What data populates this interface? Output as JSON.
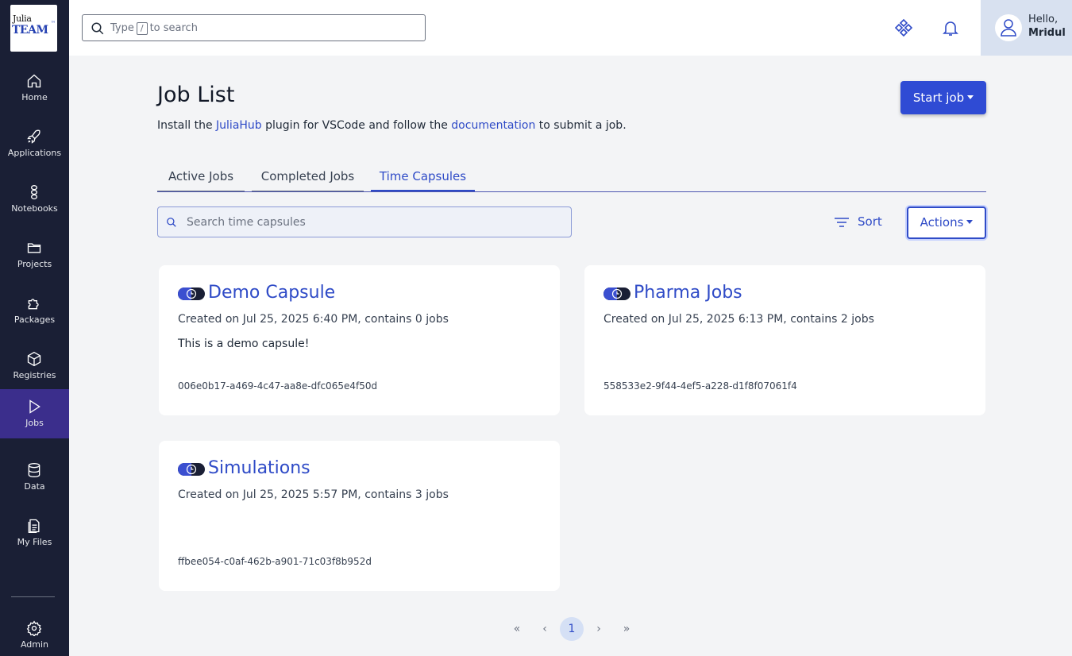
{
  "logo": {
    "line1": "Julia",
    "line2": "TEAM",
    "mark": "™"
  },
  "sidebar": {
    "items": [
      {
        "label": "Home",
        "icon": "home-icon"
      },
      {
        "label": "Applications",
        "icon": "rocket-icon"
      },
      {
        "label": "Notebooks",
        "icon": "notebook-icon"
      },
      {
        "label": "Projects",
        "icon": "folder-icon"
      },
      {
        "label": "Packages",
        "icon": "puzzle-icon"
      },
      {
        "label": "Registries",
        "icon": "box-icon"
      },
      {
        "label": "Jobs",
        "icon": "play-icon",
        "active": true
      },
      {
        "label": "Data",
        "icon": "database-icon"
      },
      {
        "label": "My Files",
        "icon": "files-icon"
      }
    ],
    "admin": {
      "label": "Admin",
      "icon": "gear-icon"
    }
  },
  "topbar": {
    "search": {
      "before": "Type",
      "key": "/",
      "after": "to search"
    },
    "user": {
      "greeting": "Hello,",
      "name": "Mridul"
    }
  },
  "page": {
    "title": "Job List",
    "intro": {
      "prefix": "Install the ",
      "link1": "JuliaHub",
      "middle": " plugin for VSCode and follow the ",
      "link2": "documentation",
      "suffix": " to submit a job."
    },
    "start_job_label": "Start job"
  },
  "tabs": [
    {
      "label": "Active Jobs"
    },
    {
      "label": "Completed Jobs"
    },
    {
      "label": "Time Capsules",
      "active": true
    }
  ],
  "toolbar": {
    "search_placeholder": "Search time capsules",
    "sort_label": "Sort",
    "actions_label": "Actions"
  },
  "capsules": [
    {
      "name": "Demo Capsule",
      "created": "Created on Jul 25, 2025 6:40 PM, contains 0 jobs",
      "description": "This is a demo capsule!",
      "id": "006e0b17-a469-4c47-aa8e-dfc065e4f50d"
    },
    {
      "name": "Pharma Jobs",
      "created": "Created on Jul 25, 2025 6:13 PM, contains 2 jobs",
      "description": "",
      "id": "558533e2-9f44-4ef5-a228-d1f8f07061f4"
    },
    {
      "name": "Simulations",
      "created": "Created on Jul 25, 2025 5:57 PM, contains 3 jobs",
      "description": "",
      "id": "ffbee054-c0af-462b-a901-71c03f8b952d"
    }
  ],
  "pagination": {
    "first": "«",
    "prev": "‹",
    "current": "1",
    "next": "›",
    "last": "»"
  },
  "colors": {
    "sidebar": "#1a1f35",
    "active_nav": "#3b2e8c",
    "accent": "#2f4bc7",
    "button": "#2f4bd4"
  }
}
